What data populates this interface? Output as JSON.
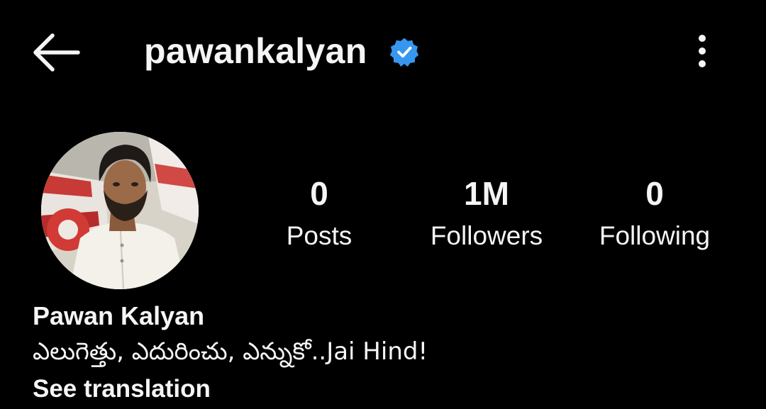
{
  "header": {
    "back_icon": "arrow-left-icon",
    "username": "pawankalyan",
    "verified_icon": "verified-badge-icon",
    "more_icon": "more-vertical-icon"
  },
  "profile": {
    "avatar_icon": "profile-photo",
    "display_name": "Pawan Kalyan",
    "bio": "ఎలుగెత్తు, ఎదురించు, ఎన్నుకో..Jai Hind!",
    "see_translation": "See translation"
  },
  "stats": [
    {
      "count": "0",
      "label": "Posts"
    },
    {
      "count": "1M",
      "label": "Followers"
    },
    {
      "count": "0",
      "label": "Following"
    }
  ],
  "colors": {
    "background": "#000000",
    "text": "#f5f5f5",
    "verified_blue": "#3797f0"
  }
}
